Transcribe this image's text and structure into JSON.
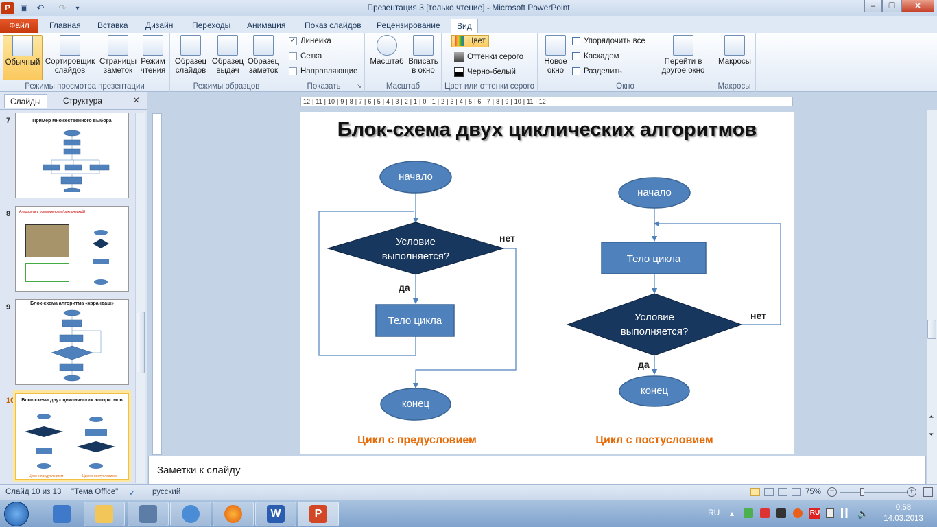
{
  "window": {
    "title": "Презентация 3 [только чтение]  -  Microsoft PowerPoint",
    "controls": {
      "minimize": "–",
      "maximize": "❐",
      "close": "✕"
    }
  },
  "tabs": [
    "Файл",
    "Главная",
    "Вставка",
    "Дизайн",
    "Переходы",
    "Анимация",
    "Показ слайдов",
    "Рецензирование",
    "Вид"
  ],
  "active_tab": "Вид",
  "ribbon": {
    "groups": {
      "modes": "Режимы просмотра презентации",
      "masters": "Режимы образцов",
      "show": "Показать",
      "zoom": "Масштаб",
      "color": "Цвет или оттенки серого",
      "window": "Окно",
      "macros": "Макросы"
    },
    "buttons": {
      "normal": "Обычный",
      "sorter": "Сортировщик слайдов",
      "notes_page": "Страницы заметок",
      "reading": "Режим чтения",
      "slide_master": "Образец слайдов",
      "handout_master": "Образец выдач",
      "notes_master": "Образец заметок",
      "zoom": "Масштаб",
      "fit": "Вписать в окно",
      "new_window": "Новое окно",
      "switch_window": "Перейти в другое окно",
      "macros": "Макросы"
    },
    "show_items": [
      {
        "label": "Линейка",
        "checked": true
      },
      {
        "label": "Сетка",
        "checked": false
      },
      {
        "label": "Направляющие",
        "checked": false
      }
    ],
    "color_items": [
      "Цвет",
      "Оттенки серого",
      "Черно-белый"
    ],
    "window_items": [
      "Упорядочить все",
      "Каскадом",
      "Разделить"
    ]
  },
  "left_pane": {
    "tabs": [
      "Слайды",
      "Структура"
    ],
    "close": "×",
    "thumbs": [
      {
        "num": "7",
        "title": "Пример множественного выбора"
      },
      {
        "num": "8",
        "title": "Алгоритм с повторением (циклический)"
      },
      {
        "num": "9",
        "title": "Блок-схема алгоритма «карандаш»"
      },
      {
        "num": "10",
        "title": "Блок-схема двух циклических алгоритмов"
      }
    ]
  },
  "slide": {
    "title": "Блок-схема двух циклических алгоритмов",
    "left": {
      "start": "начало",
      "cond_line1": "Условие",
      "cond_line2": "выполняется?",
      "yes": "да",
      "no": "нет",
      "body": "Тело цикла",
      "end": "конец",
      "caption": "Цикл с предусловием"
    },
    "right": {
      "start": "начало",
      "body": "Тело цикла",
      "cond_line1": "Условие",
      "cond_line2": "выполняется?",
      "yes": "да",
      "no": "нет",
      "end": "конец",
      "caption": "Цикл с постусловием"
    }
  },
  "ruler_h": "·12·|·11·|·10·|·9·|·8·|·7·|·6·|·5·|·4·|·3·|·2·|·1·|·0·|·1·|·2·|·3·|·4·|·5·|·6·|·7·|·8·|·9·|·10·|·11·|·12·",
  "notes_placeholder": "Заметки к слайду",
  "status": {
    "slide": "Слайд 10 из 13",
    "theme": "\"Тема Office\"",
    "lang": "русский",
    "zoom": "75%"
  },
  "tray": {
    "lang": "RU",
    "time": "0:58",
    "date": "14.03.2013"
  },
  "colors": {
    "shape_fill": "#4f81bd",
    "shape_border": "#3a6595",
    "diamond_fill": "#17375e",
    "caption": "#e46c0a",
    "line": "#4f81bd"
  }
}
